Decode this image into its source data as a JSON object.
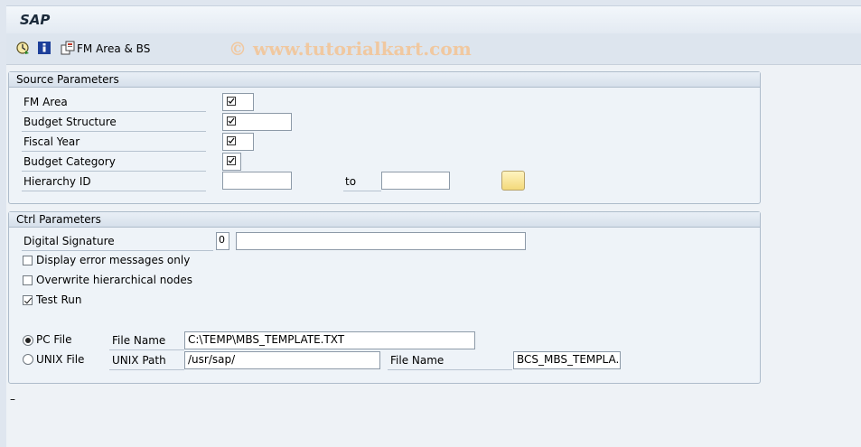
{
  "title": "SAP",
  "watermark": "© www.tutorialkart.com",
  "toolbar": {
    "execute_icon": "execute-clock-icon",
    "info_icon": "info-icon",
    "fm_area_bs_icon": "copy-document-icon",
    "fm_area_bs_label": "FM Area & BS"
  },
  "source": {
    "header": "Source Parameters",
    "fm_area_label": "FM Area",
    "budget_structure_label": "Budget Structure",
    "fiscal_year_label": "Fiscal Year",
    "budget_category_label": "Budget Category",
    "hierarchy_id_label": "Hierarchy ID",
    "hierarchy_from": "",
    "to_label": "to",
    "hierarchy_to": "",
    "multiple_selection_icon": "multiple-selection-icon"
  },
  "ctrl": {
    "header": "Ctrl Parameters",
    "digital_signature_label": "Digital Signature",
    "digital_signature_value": "0",
    "digital_signature_text": "",
    "display_errors_label": "Display error messages only",
    "display_errors_checked": false,
    "overwrite_label": "Overwrite hierarchical nodes",
    "overwrite_checked": false,
    "test_run_label": "Test Run",
    "test_run_checked": true,
    "pc_file_label": "PC File",
    "pc_file_selected": true,
    "file_name_label": "File Name",
    "pc_file_name": "C:\\TEMP\\MBS_TEMPLATE.TXT",
    "unix_file_label": "UNIX File",
    "unix_file_selected": false,
    "unix_path_label": "UNIX Path",
    "unix_path_value": "/usr/sap/",
    "unix_file_name_label": "File Name",
    "unix_file_name": "BCS_MBS_TEMPLA..."
  },
  "status": "–"
}
